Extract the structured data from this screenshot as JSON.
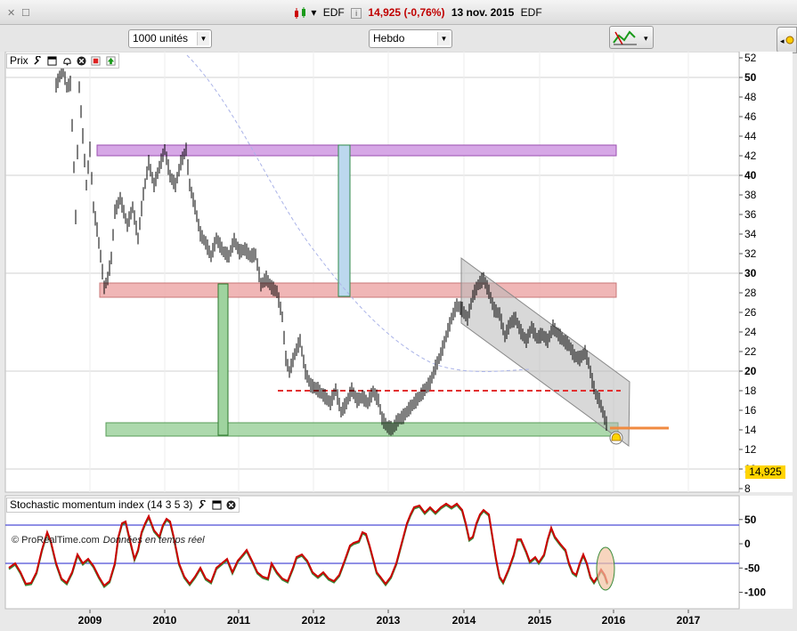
{
  "window": {
    "title_instrument": "EDF",
    "title_price": "14,925 (-0,76%)",
    "title_date": "13 nov. 2015",
    "title_suffix": "EDF",
    "info_glyph": "i"
  },
  "toolbar": {
    "units_select": "1000 unités",
    "period_select": "Hebdo"
  },
  "price_panel": {
    "label": "Prix",
    "copyright": "© ProRealTime.com",
    "realtime_note": "Données en temps réel",
    "last_price": "14,925",
    "y_ticks": [
      "52",
      "50",
      "48",
      "46",
      "44",
      "42",
      "40",
      "38",
      "36",
      "34",
      "32",
      "30",
      "28",
      "26",
      "24",
      "22",
      "20",
      "18",
      "16",
      "14",
      "12",
      "10",
      "8"
    ],
    "bold_ticks": [
      "50",
      "40",
      "30",
      "20",
      "10"
    ]
  },
  "indicator_panel": {
    "label": "Stochastic momentum index (14 3 5 3)",
    "y_ticks": [
      "50",
      "0",
      "-50",
      "-100"
    ]
  },
  "x_axis": {
    "labels": [
      "2009",
      "2010",
      "2011",
      "2012",
      "2013",
      "2014",
      "2015",
      "2016",
      "2017"
    ]
  },
  "colors": {
    "zone_purple": "#d6a7e6",
    "zone_pink": "#eeaaaa",
    "zone_green": "#9fd39f",
    "dashed_support": "#e23030",
    "orange_line": "#f08a40",
    "channel_fill": "#b8b8b8",
    "price_tag": "#ffd400",
    "smi_red": "#cc0000",
    "smi_green": "#3c8c3c",
    "smi_levels": "#2222cc"
  },
  "icons": [
    "wrench-icon",
    "window-icon",
    "alarm-icon",
    "close-icon",
    "red-square-icon",
    "green-arrow-icon"
  ]
}
